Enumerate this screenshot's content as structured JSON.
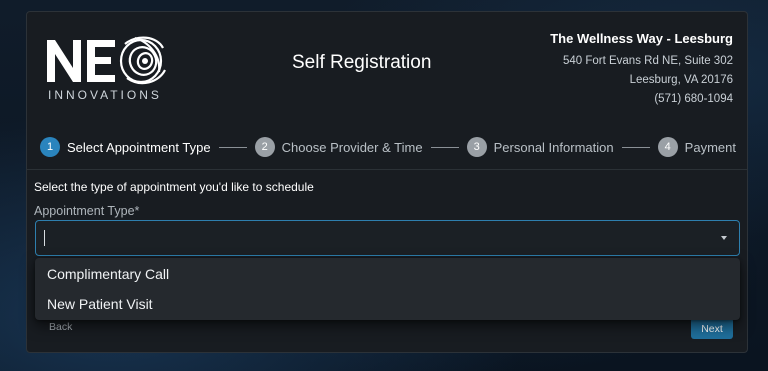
{
  "logo": {
    "wordmark": "NEO",
    "subtitle": "INNOVATIONS",
    "icon": "eye-swirl-logo"
  },
  "page_title": "Self Registration",
  "clinic": {
    "name": "The Wellness Way - Leesburg",
    "address_line1": "540 Fort Evans Rd NE, Suite 302",
    "address_line2": "Leesburg, VA 20176",
    "phone": "(571) 680-1094"
  },
  "steps": [
    {
      "num": "1",
      "label": "Select Appointment Type",
      "active": true
    },
    {
      "num": "2",
      "label": "Choose Provider & Time",
      "active": false
    },
    {
      "num": "3",
      "label": "Personal Information",
      "active": false
    },
    {
      "num": "4",
      "label": "Payment",
      "active": false
    }
  ],
  "form": {
    "prompt": "Select the type of appointment you'd like to schedule",
    "field_label": "Appointment Type*",
    "value": "",
    "dropdown_icon": "caret-down-icon"
  },
  "options": [
    "Complimentary Call",
    "New Patient Visit"
  ],
  "buttons": {
    "back": "Back",
    "next": "Next"
  },
  "colors": {
    "accent": "#2a84bd",
    "next_button": "#1f6f9c",
    "card": "#181c21",
    "inactive_step": "#9aa0a6"
  }
}
